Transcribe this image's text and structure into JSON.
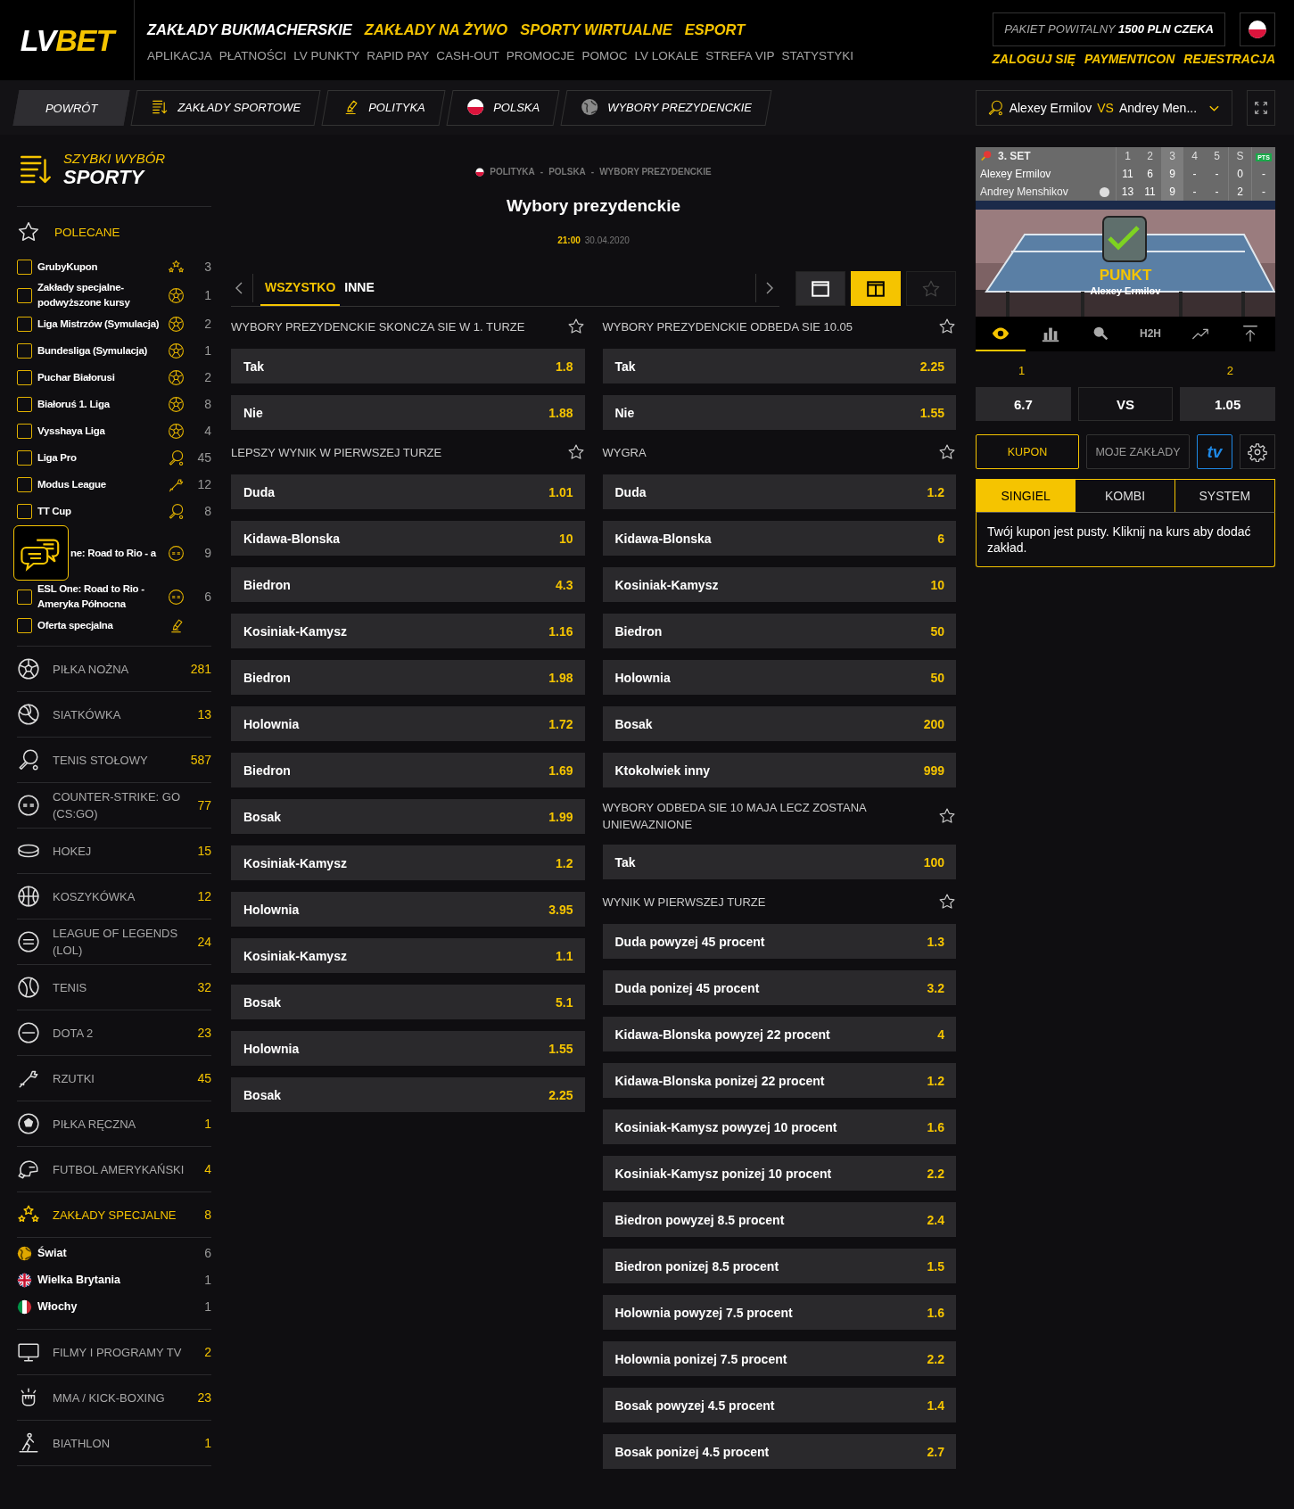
{
  "header": {
    "logo_left": "LV",
    "logo_right": "BET",
    "main_nav": [
      {
        "label": "ZAKŁADY BUKMACHERSKIE",
        "selected": true
      },
      {
        "label": "ZAKŁADY NA ŻYWO",
        "selected": false
      },
      {
        "label": "SPORTY WIRTUALNE",
        "selected": false
      },
      {
        "label": "ESPORT",
        "selected": false
      }
    ],
    "sub_nav": [
      "APLIKACJA",
      "PŁATNOŚCI",
      "LV PUNKTY",
      "RAPID PAY",
      "CASH-OUT",
      "PROMOCJE",
      "POMOC",
      "LV LOKALE",
      "STREFA VIP",
      "STATYSTYKI"
    ],
    "promo": "PAKIET POWITALNY **1500 PLN CZEKA**",
    "account_links": [
      "ZALOGUJ SIĘ",
      "PAYMENTICON",
      "REJESTRACJA"
    ]
  },
  "crumb_bar": {
    "back": "POWRÓT",
    "items": [
      {
        "label": "ZAKŁADY SPORTOWE",
        "kind": "list"
      },
      {
        "label": "POLITYKA",
        "kind": "pen"
      },
      {
        "label": "POLSKA",
        "kind": "poland"
      },
      {
        "label": "WYBORY PREZYDENCKIE",
        "kind": "globe"
      }
    ],
    "event_selector": {
      "player_1": "Alexey Ermilov",
      "vs": "VS",
      "player_2": "Andrey Men..."
    }
  },
  "sidebar": {
    "title_top": "SZYBKI WYBÓR",
    "title_bottom": "SPORTY",
    "featured_label": "POLECANE",
    "featured": [
      {
        "label": "GrubyKupon",
        "kind": "stars",
        "count": "3",
        "checked": false
      },
      {
        "label": "Zakłady specjalne-podwyższone kursy",
        "kind": "soccer",
        "count": "1",
        "checked": false
      },
      {
        "label": "Liga Mistrzów (Symulacja)",
        "kind": "soccer",
        "count": "2",
        "checked": false
      },
      {
        "label": "Bundesliga (Symulacja)",
        "kind": "soccer",
        "count": "1",
        "checked": false
      },
      {
        "label": "Puchar Białorusi",
        "kind": "soccer",
        "count": "2",
        "checked": false
      },
      {
        "label": "Białoruś 1. Liga",
        "kind": "soccer",
        "count": "8",
        "checked": false
      },
      {
        "label": "Vysshaya Liga",
        "kind": "soccer",
        "count": "4",
        "checked": false
      },
      {
        "label": "Liga Pro",
        "kind": "paddle",
        "count": "45",
        "checked": false
      },
      {
        "label": "Modus League",
        "kind": "dart",
        "count": "12",
        "checked": false
      },
      {
        "label": "TT Cup",
        "kind": "paddle",
        "count": "8",
        "checked": false
      },
      {
        "label": "ne: Road to Rio - a",
        "kind": "csgo",
        "count": "9",
        "covered": true
      },
      {
        "label": "ESL One: Road to Rio - Ameryka Północna",
        "kind": "csgo",
        "count": "6",
        "checked": false
      },
      {
        "label": "Oferta specjalna",
        "kind": "pen",
        "checked": false
      }
    ],
    "sports": [
      {
        "label": "PIŁKA NOŻNA",
        "kind": "soccer",
        "count": "281",
        "expanded": false
      },
      {
        "label": "SIATKÓWKA",
        "kind": "volleyball",
        "count": "13",
        "expanded": false
      },
      {
        "label": "TENIS STOŁOWY",
        "kind": "paddle",
        "count": "587",
        "expanded": false
      },
      {
        "label": "COUNTER-STRIKE: GO (CS:GO)",
        "kind": "csgo",
        "count": "77",
        "expanded": false
      },
      {
        "label": "HOKEJ",
        "kind": "puck",
        "count": "15",
        "expanded": false
      },
      {
        "label": "KOSZYKÓWKA",
        "kind": "basketball",
        "count": "12",
        "expanded": false
      },
      {
        "label": "LEAGUE OF LEGENDS (LOL)",
        "kind": "lol",
        "count": "24",
        "expanded": false
      },
      {
        "label": "TENIS",
        "kind": "tennis",
        "count": "32",
        "expanded": false
      },
      {
        "label": "DOTA 2",
        "kind": "dota",
        "count": "23",
        "expanded": false
      },
      {
        "label": "RZUTKI",
        "kind": "dart",
        "count": "45",
        "expanded": false
      },
      {
        "label": "PIŁKA RĘCZNA",
        "kind": "handball",
        "count": "1",
        "expanded": false
      },
      {
        "label": "FUTBOL AMERYKAŃSKI",
        "kind": "helmet",
        "count": "4",
        "expanded": false
      },
      {
        "label": "ZAKŁADY SPECJALNE",
        "kind": "stars",
        "count": "8",
        "expanded": true,
        "children": [
          {
            "label": "Świat",
            "kind": "globe",
            "count": "6"
          },
          {
            "label": "Wielka Brytania",
            "kind": "uk",
            "count": "1"
          },
          {
            "label": "Włochy",
            "kind": "italy",
            "count": "1"
          }
        ]
      },
      {
        "label": "FILMY I PROGRAMY TV",
        "kind": "tv",
        "count": "2",
        "expanded": false
      },
      {
        "label": "MMA / KICK-BOXING",
        "kind": "glove",
        "count": "23",
        "expanded": false
      },
      {
        "label": "BIATHLON",
        "kind": "skier",
        "count": "1",
        "expanded": false
      }
    ]
  },
  "event": {
    "breadcrumb": [
      "POLITYKA",
      "POLSKA",
      "WYBORY PREZYDENCKIE"
    ],
    "breadcrumb_separator": "-",
    "title": "Wybory prezydenckie",
    "time": "21:00",
    "date": "30.04.2020",
    "tabs": [
      {
        "label": "WSZYSTKO",
        "selected": true
      },
      {
        "label": "INNE",
        "selected": false
      }
    ],
    "views": [
      {
        "kind": "single",
        "selected": false
      },
      {
        "kind": "double",
        "selected": true
      },
      {
        "kind": "favorite",
        "selected": false
      }
    ],
    "columns": [
      [
        {
          "title": "WYBORY PREZYDENCKIE SKONCZA SIE W 1. TURZE",
          "outcomes": [
            {
              "name": "Tak",
              "odds": "1.8"
            },
            {
              "name": "Nie",
              "odds": "1.88"
            }
          ]
        },
        {
          "title": "LEPSZY WYNIK W PIERWSZEJ TURZE",
          "outcomes": [
            {
              "name": "Duda",
              "odds": "1.01"
            },
            {
              "name": "Kidawa-Blonska",
              "odds": "10"
            },
            {
              "name": "Biedron",
              "odds": "4.3"
            },
            {
              "name": "Kosiniak-Kamysz",
              "odds": "1.16"
            },
            {
              "name": "Biedron",
              "odds": "1.98"
            },
            {
              "name": "Holownia",
              "odds": "1.72"
            },
            {
              "name": "Biedron",
              "odds": "1.69"
            },
            {
              "name": "Bosak",
              "odds": "1.99"
            },
            {
              "name": "Kosiniak-Kamysz",
              "odds": "1.2"
            },
            {
              "name": "Holownia",
              "odds": "3.95"
            },
            {
              "name": "Kosiniak-Kamysz",
              "odds": "1.1"
            },
            {
              "name": "Bosak",
              "odds": "5.1"
            },
            {
              "name": "Holownia",
              "odds": "1.55"
            },
            {
              "name": "Bosak",
              "odds": "2.25"
            }
          ]
        }
      ],
      [
        {
          "title": "WYBORY PREZYDENCKIE ODBEDA SIE 10.05",
          "outcomes": [
            {
              "name": "Tak",
              "odds": "2.25"
            },
            {
              "name": "Nie",
              "odds": "1.55"
            }
          ]
        },
        {
          "title": "WYGRA",
          "outcomes": [
            {
              "name": "Duda",
              "odds": "1.2"
            },
            {
              "name": "Kidawa-Blonska",
              "odds": "6"
            },
            {
              "name": "Kosiniak-Kamysz",
              "odds": "10"
            },
            {
              "name": "Biedron",
              "odds": "50"
            },
            {
              "name": "Holownia",
              "odds": "50"
            },
            {
              "name": "Bosak",
              "odds": "200"
            },
            {
              "name": "Ktokolwiek inny",
              "odds": "999"
            }
          ]
        },
        {
          "title": "WYBORY ODBEDA SIE 10 MAJA LECZ ZOSTANA UNIEWAZNIONE",
          "outcomes": [
            {
              "name": "Tak",
              "odds": "100"
            }
          ]
        },
        {
          "title": "WYNIK W PIERWSZEJ TURZE",
          "outcomes": [
            {
              "name": "Duda powyzej 45 procent",
              "odds": "1.3"
            },
            {
              "name": "Duda ponizej 45 procent",
              "odds": "3.2"
            },
            {
              "name": "Kidawa-Blonska powyzej 22 procent",
              "odds": "4"
            },
            {
              "name": "Kidawa-Blonska ponizej 22 procent",
              "odds": "1.2"
            },
            {
              "name": "Kosiniak-Kamysz powyzej 10 procent",
              "odds": "1.6"
            },
            {
              "name": "Kosiniak-Kamysz ponizej 10 procent",
              "odds": "2.2"
            },
            {
              "name": "Biedron powyzej 8.5 procent",
              "odds": "2.4"
            },
            {
              "name": "Biedron ponizej 8.5 procent",
              "odds": "1.5"
            },
            {
              "name": "Holownia powyzej 7.5 procent",
              "odds": "1.6"
            },
            {
              "name": "Holownia ponizej 7.5 procent",
              "odds": "2.2"
            },
            {
              "name": "Bosak powyzej 4.5 procent",
              "odds": "1.4"
            },
            {
              "name": "Bosak ponizej 4.5 procent",
              "odds": "2.7"
            }
          ]
        }
      ]
    ]
  },
  "live_widget": {
    "set": "3. SET",
    "headers": [
      {
        "label": "1",
        "current": false
      },
      {
        "label": "2",
        "current": false
      },
      {
        "label": "3",
        "current": true
      },
      {
        "label": "4",
        "current": false
      },
      {
        "label": "5",
        "current": false
      },
      {
        "label": "S",
        "current": false
      }
    ],
    "pts_badge": "PTS",
    "players": [
      {
        "name": "Alexey Ermilov",
        "serving": false,
        "scores": [
          "11",
          "6",
          "9",
          "-",
          "-"
        ],
        "sets": "0",
        "pts": "-"
      },
      {
        "name": "Andrey Menshikov",
        "serving": true,
        "scores": [
          "13",
          "11",
          "9",
          "-",
          "-"
        ],
        "sets": "2",
        "pts": "-"
      }
    ],
    "overlay_title": "PUNKT",
    "overlay_player": "Alexey Ermilov",
    "toolbar": [
      {
        "kind": "eye",
        "selected": true
      },
      {
        "kind": "stats",
        "selected": false
      },
      {
        "kind": "search",
        "selected": false
      },
      {
        "kind": "text",
        "label": "H2H",
        "selected": false
      },
      {
        "kind": "trend",
        "selected": false
      },
      {
        "kind": "top",
        "selected": false
      }
    ],
    "odds_labels": [
      "1",
      "2"
    ],
    "odds": [
      "6.7",
      "VS",
      "1.05"
    ]
  },
  "bet_slip": {
    "tabs": [
      {
        "label": "KUPON",
        "selected": true
      },
      {
        "label": "MOJE ZAKŁADY",
        "selected": false
      }
    ],
    "tv": "tv",
    "types": [
      {
        "label": "SINGIEL",
        "selected": true
      },
      {
        "label": "KOMBI",
        "selected": false
      },
      {
        "label": "SYSTEM",
        "selected": false
      }
    ],
    "message": "Twój kupon jest pusty. Kliknij na kurs aby dodać zakład."
  }
}
